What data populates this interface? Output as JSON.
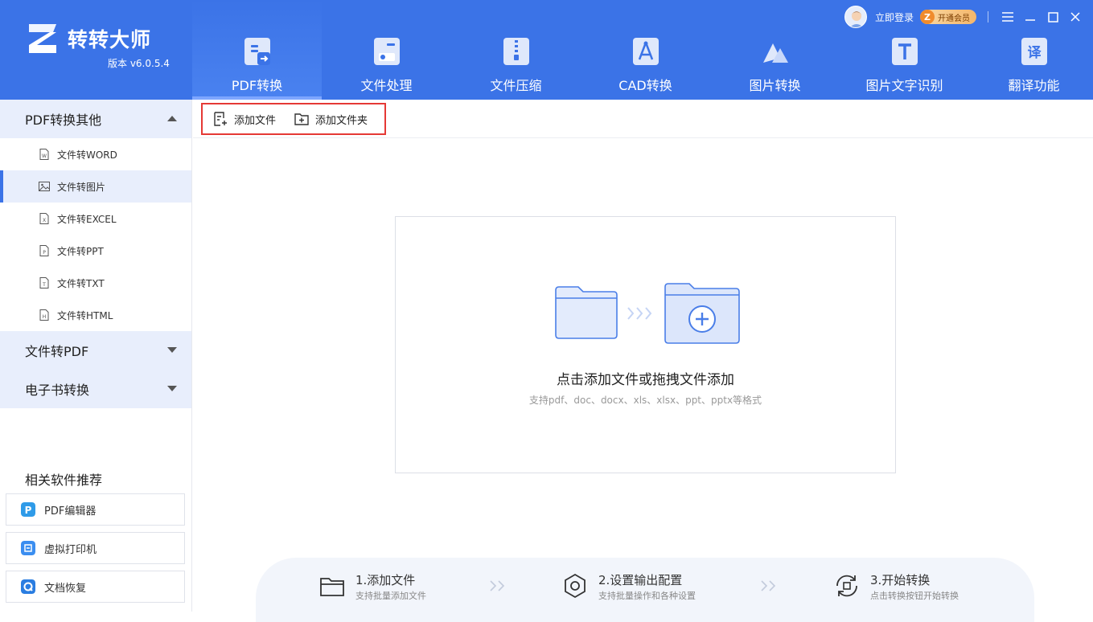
{
  "app": {
    "name": "转转大师",
    "version": "版本 v6.0.5.4"
  },
  "user": {
    "login": "立即登录",
    "vip": "开通会员",
    "vip_mark": "Z"
  },
  "nav": [
    {
      "label": "PDF转换",
      "icon": "pdf-convert-icon",
      "active": true
    },
    {
      "label": "文件处理",
      "icon": "file-process-icon"
    },
    {
      "label": "文件压缩",
      "icon": "file-zip-icon"
    },
    {
      "label": "CAD转换",
      "icon": "cad-icon"
    },
    {
      "label": "图片转换",
      "icon": "image-convert-icon"
    },
    {
      "label": "图片文字识别",
      "icon": "ocr-icon"
    },
    {
      "label": "翻译功能",
      "icon": "translate-icon"
    }
  ],
  "sidebar": {
    "groups": [
      {
        "label": "PDF转换其他",
        "expanded": true
      },
      {
        "label": "文件转PDF",
        "expanded": false
      },
      {
        "label": "电子书转换",
        "expanded": false
      }
    ],
    "items": [
      {
        "label": "文件转WORD",
        "icon": "word-file-icon",
        "glyph": "W"
      },
      {
        "label": "文件转图片",
        "icon": "image-file-icon",
        "active": true
      },
      {
        "label": "文件转EXCEL",
        "icon": "excel-file-icon",
        "glyph": "X"
      },
      {
        "label": "文件转PPT",
        "icon": "ppt-file-icon",
        "glyph": "P"
      },
      {
        "label": "文件转TXT",
        "icon": "txt-file-icon",
        "glyph": "T"
      },
      {
        "label": "文件转HTML",
        "icon": "html-file-icon",
        "glyph": "H"
      }
    ],
    "recommend_title": "相关软件推荐",
    "recommend": [
      {
        "label": "PDF编辑器",
        "icon": "pdf-editor-icon",
        "color": "#2f9be8"
      },
      {
        "label": "虚拟打印机",
        "icon": "printer-icon",
        "color": "#3b8ef0"
      },
      {
        "label": "文档恢复",
        "icon": "recovery-icon",
        "color": "#2a7de1"
      }
    ]
  },
  "toolbar": {
    "add_file": "添加文件",
    "add_folder": "添加文件夹"
  },
  "dropzone": {
    "title": "点击添加文件或拖拽文件添加",
    "subtitle": "支持pdf、doc、docx、xls、xlsx、ppt、pptx等格式"
  },
  "steps": [
    {
      "title": "1.添加文件",
      "desc": "支持批量添加文件",
      "icon": "folder-icon"
    },
    {
      "title": "2.设置输出配置",
      "desc": "支持批量操作和各种设置",
      "icon": "settings-icon"
    },
    {
      "title": "3.开始转换",
      "desc": "点击转换按钮开始转换",
      "icon": "convert-icon"
    }
  ],
  "colors": {
    "brand": "#3b73e7",
    "highlight": "#e53935",
    "active_bg": "#e8eefc"
  }
}
